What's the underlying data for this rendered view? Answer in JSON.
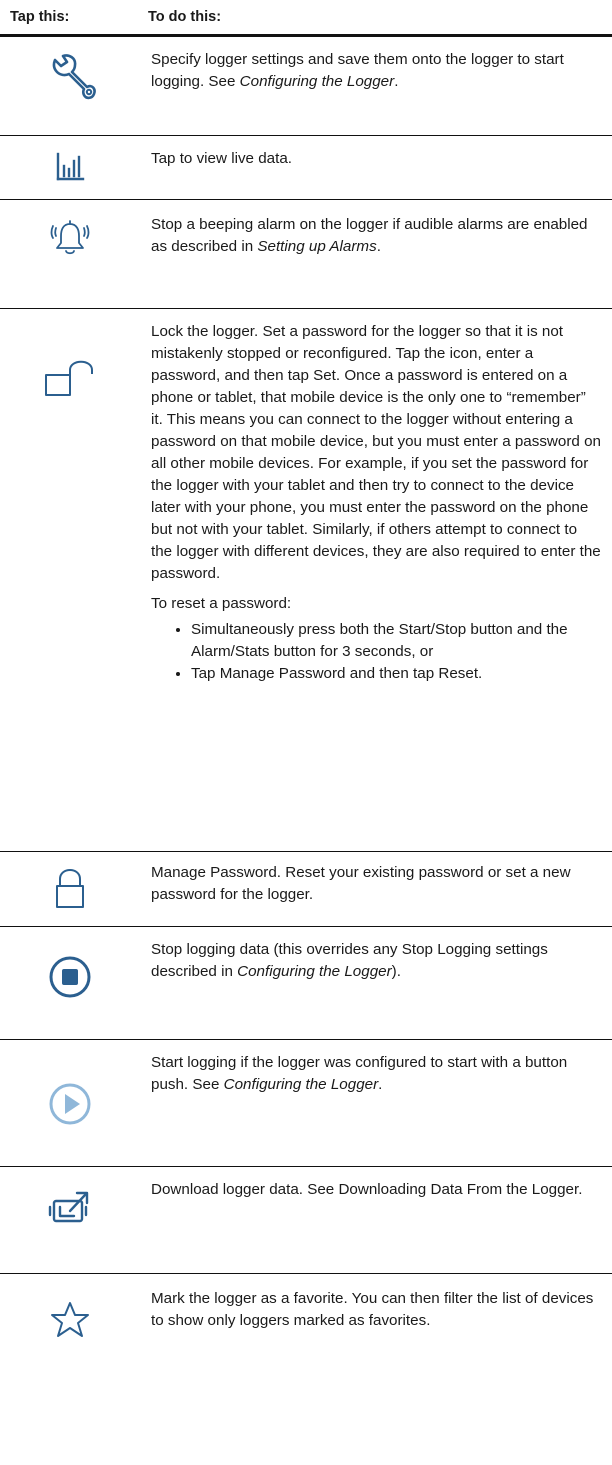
{
  "header": {
    "col1": "Tap this:",
    "col2": "To do this:"
  },
  "rows": {
    "configure": {
      "icon": "wrench-icon",
      "t1": "Specify logger settings and save them onto the logger to start logging. See ",
      "em": "Configuring the Logger",
      "t2": "."
    },
    "live": {
      "icon": "bar-chart-icon",
      "text": "Tap to view live data."
    },
    "alarm": {
      "icon": "bell-icon",
      "t1": "Stop a beeping alarm on the logger if audible alarms are enabled as described in ",
      "em": "Setting up Alarms",
      "t2": "."
    },
    "lock": {
      "icon": "unlocked-padlock-icon",
      "text": "Lock the logger. Set a password for the logger so that it is not mistakenly stopped or reconfigured. Tap the icon, enter a password, and then tap Set. Once a password is entered on a phone or tablet, that mobile device is the only one to “remember” it. This means you can connect to the logger without entering a password on that mobile device, but you must enter a password on all other mobile devices. For example, if you set the password for the logger with your tablet and then try to connect to the device later with your phone, you must enter the password on the phone but not with your tablet. Similarly, if others attempt to connect to the logger with different devices, they are also required to enter the password.",
      "reset_lead": "To reset a password:",
      "bullets": [
        "Simultaneously press both the Start/Stop button and the Alarm/Stats button for 3 seconds, or",
        "Tap Manage Password and then tap Reset."
      ]
    },
    "manage": {
      "icon": "locked-padlock-icon",
      "text": "Manage Password. Reset your existing password or set a new password for the logger."
    },
    "stop": {
      "icon": "stop-button-icon",
      "t1": "Stop logging data (this overrides any Stop Logging settings described in ",
      "em": "Configuring the Logger",
      "t2": ")."
    },
    "start": {
      "icon": "play-button-icon",
      "t1": "Start logging if the logger was configured to start with a button push. See ",
      "em": "Configuring the Logger",
      "t2": "."
    },
    "download": {
      "icon": "download-icon",
      "text": "Download logger data. See Downloading Data From the Logger."
    },
    "favorite": {
      "icon": "star-icon",
      "text": "Mark the logger as a favorite. You can then filter the list of devices to show only loggers marked as favorites."
    }
  },
  "colors": {
    "icon_blue": "#2b5f8f",
    "icon_light": "#8fb7d9",
    "rule": "#111111"
  }
}
